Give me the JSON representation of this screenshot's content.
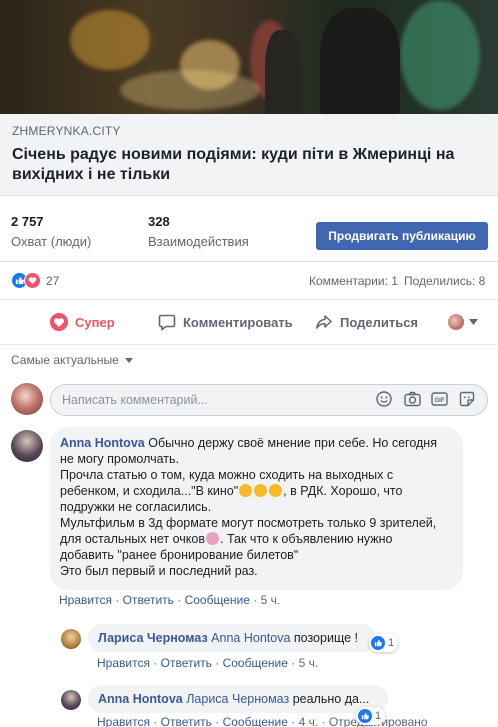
{
  "link_preview": {
    "domain": "ZHMERYNKA.CITY",
    "headline": "Січень радує новими подіями: куди піти в Жмеринці на вихідних і не тільки"
  },
  "insights": {
    "reach_value": "2 757",
    "reach_label": "Охват (люди)",
    "engagement_value": "328",
    "engagement_label": "Взаимодействия",
    "promote_label": "Продвигать публикацию"
  },
  "reactions": {
    "count": "27",
    "comments": "Комментарии: 1",
    "shares": "Поделились: 8"
  },
  "actions": {
    "super": "Супер",
    "comment": "Комментировать",
    "share": "Поделиться"
  },
  "sort_label": "Самые актуальные",
  "composer": {
    "placeholder": "Написать комментарий..."
  },
  "comments": [
    {
      "author": "Anna Hontova",
      "line1": "Обычно держу своё мнение при себе. Но сегодня",
      "line2": "не могу промолчать.",
      "line3": "Прочла статью о том, куда можно сходить на выходных с",
      "line4a": "ребенком, и сходила...\"В кино\"",
      "line4b": ", в РДК. Хорошо, что",
      "line5": "подружки не согласились.",
      "line6": "Мультфильм в 3д формате могут посмотреть только 9 зрителей,",
      "line7": "для остальных нет очков",
      "line8": "добавить \"ранее бронирование билетов\"",
      "line7b": ". Так что к объявлению нужно",
      "line9": "Это был первый и последний раз.",
      "like": "Нравится",
      "reply": "Ответить",
      "message": "Сообщение",
      "time": "5 ч."
    },
    {
      "author": "Лариса Черномаз",
      "mention": "Anna Hontova",
      "text": "позорище !",
      "likes": "1",
      "like": "Нравится",
      "reply": "Ответить",
      "message": "Сообщение",
      "time": "5 ч."
    },
    {
      "author": "Anna Hontova",
      "mention": "Лариса Черномаз",
      "text": "реально да...",
      "likes": "1",
      "like": "Нравится",
      "reply": "Ответить",
      "message": "Сообщение",
      "time": "4 ч.",
      "edited": "Отредактировано"
    }
  ],
  "colors": {
    "brand": "#4267b2",
    "link": "#385898",
    "love": "#f25268",
    "like": "#1877f2"
  }
}
